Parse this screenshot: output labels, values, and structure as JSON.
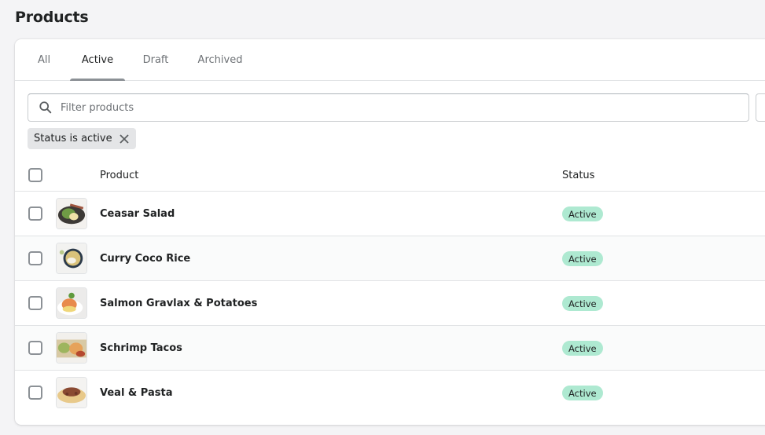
{
  "page": {
    "title": "Products"
  },
  "tabs": [
    {
      "label": "All",
      "active": false
    },
    {
      "label": "Active",
      "active": true
    },
    {
      "label": "Draft",
      "active": false
    },
    {
      "label": "Archived",
      "active": false
    }
  ],
  "search": {
    "placeholder": "Filter products",
    "value": "",
    "icon": "search-icon"
  },
  "filter_chip": {
    "label": "Status is active",
    "icon": "close-icon"
  },
  "table": {
    "columns": [
      "Product",
      "Status"
    ],
    "rows": [
      {
        "name": "Ceasar Salad",
        "status": "Active",
        "thumbnail": "salad"
      },
      {
        "name": "Curry Coco Rice",
        "status": "Active",
        "thumbnail": "rice-bowl"
      },
      {
        "name": "Salmon Gravlax & Potatoes",
        "status": "Active",
        "thumbnail": "salmon-plate"
      },
      {
        "name": "Schrimp Tacos",
        "status": "Active",
        "thumbnail": "tacos"
      },
      {
        "name": "Veal & Pasta",
        "status": "Active",
        "thumbnail": "pasta"
      }
    ]
  },
  "colors": {
    "page_bg": "#f4f4f6",
    "active_badge_bg": "#aee9d1",
    "tab_indicator": "#8c9196",
    "chip_bg": "#e4e5e7"
  }
}
